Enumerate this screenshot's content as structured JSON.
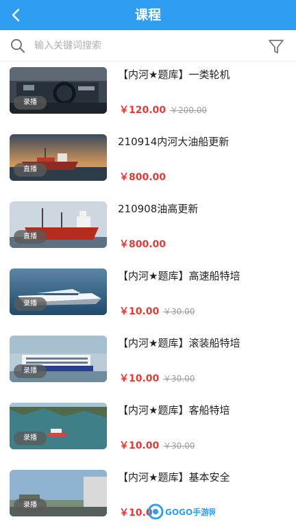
{
  "header": {
    "title": "课程"
  },
  "search": {
    "placeholder": "输入关键词搜索"
  },
  "courses": [
    {
      "title": "【内河★题库】一类轮机",
      "price": "￥120.00",
      "original_price": "￥200.00",
      "mode": "录播"
    },
    {
      "title": "210914内河大油船更新",
      "price": "￥800.00",
      "original_price": "",
      "mode": "直播"
    },
    {
      "title": "210908油高更新",
      "price": "￥800.00",
      "original_price": "",
      "mode": "直播"
    },
    {
      "title": "【内河★题库】高速船特培",
      "price": "￥10.00",
      "original_price": "￥30.00",
      "mode": "录播"
    },
    {
      "title": "【内河★题库】滚装船特培",
      "price": "￥10.00",
      "original_price": "￥30.00",
      "mode": "录播"
    },
    {
      "title": "【内河★题库】客船特培",
      "price": "￥10.00",
      "original_price": "￥30.00",
      "mode": "录播"
    },
    {
      "title": "【内河★题库】基本安全",
      "price": "￥10.0",
      "original_price": "",
      "mode": "录播"
    }
  ],
  "watermark": {
    "text": "GOGO手游网"
  },
  "colors": {
    "header": "#2f9ef0",
    "price": "#e53935",
    "original_price": "#9e9e9e"
  },
  "icons": {
    "back": "chevron-left-icon",
    "search": "search-icon",
    "filter": "filter-icon"
  }
}
